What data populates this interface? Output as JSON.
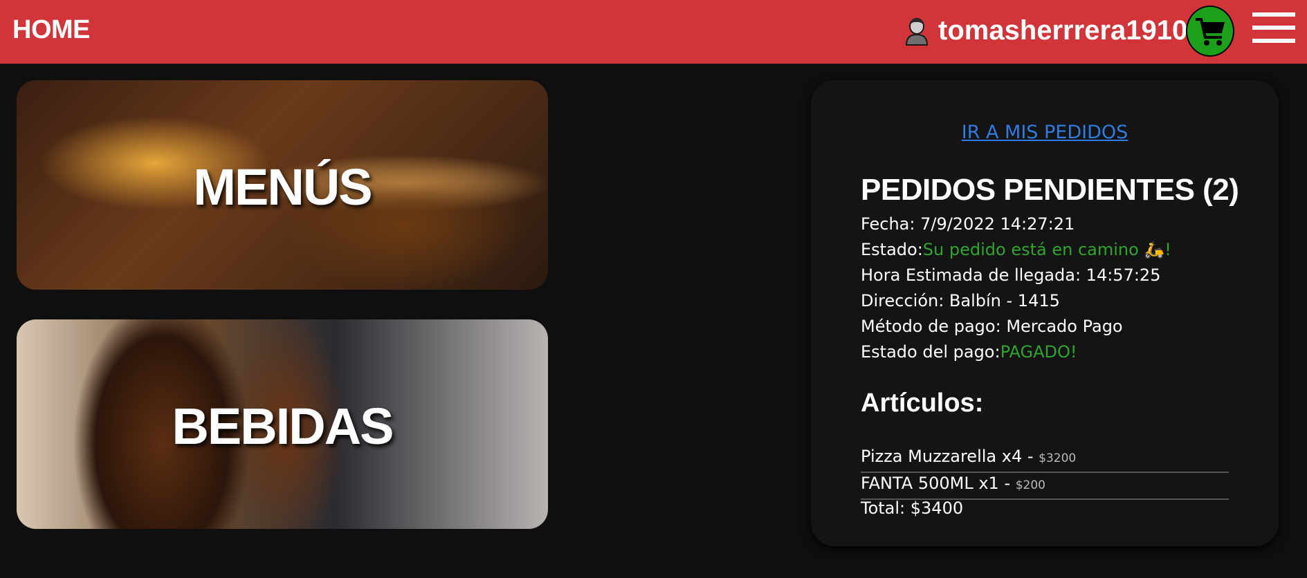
{
  "header": {
    "home_label": "HOME",
    "username": "tomasherrrera1910",
    "cart_color": "#1ca01c",
    "bar_color": "#d23539"
  },
  "categories": [
    {
      "label": "MENÚS"
    },
    {
      "label": "BEBIDAS"
    }
  ],
  "orders_panel": {
    "link_label": "IR A MIS PEDIDOS",
    "title": "PEDIDOS PENDIENTES (2)",
    "fecha_label": "Fecha: ",
    "fecha_value": "7/9/2022 14:27:21",
    "estado_label": "Estado:",
    "estado_value": "Su pedido está en camino 🛵!",
    "hora_label": "Hora Estimada de llegada: ",
    "hora_value": "14:57:25",
    "direccion_label": "Dirección: ",
    "direccion_value": "Balbín - 1415",
    "metodo_label": "Método de pago: ",
    "metodo_value": "Mercado Pago",
    "estado_pago_label": "Estado del pago:",
    "estado_pago_value": "PAGADO!",
    "articulos_title": "Artículos:",
    "items": [
      {
        "name": "Pizza Muzzarella x4",
        "sep": " - ",
        "price": "$3200"
      },
      {
        "name": "FANTA 500ML x1",
        "sep": " - ",
        "price": "$200"
      }
    ],
    "total_label": "Total: ",
    "total_value": "$3400",
    "status_color": "#2fa52f",
    "link_color": "#2f7de0"
  }
}
